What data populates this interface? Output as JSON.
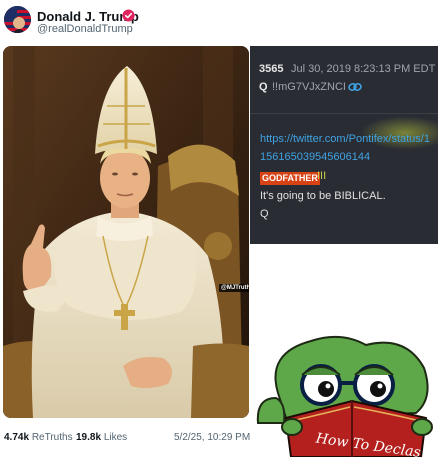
{
  "header": {
    "display_name": "Donald J. Trump",
    "handle": "@realDonaldTrump",
    "avatar_icon": "avatar-flag-image",
    "verified_icon": "verified-badge-icon",
    "verified_color": "#e0245e"
  },
  "image": {
    "watermark": "@MJTruthUltra"
  },
  "q_post": {
    "number": "3565",
    "date": "Jul 30, 2019 8:23:13 PM EDT",
    "author": "Q",
    "tripcode": "!!mG7VJxZNCI",
    "link_icon": "link-chain-icon",
    "link": "https://twitter.com/Pontifex/status/1156165039545606144",
    "badge": "GODFATHER",
    "badge_suffix": "III",
    "message": "It's going to be BIBLICAL.",
    "signature": "Q",
    "badge_color": "#d84315",
    "link_color": "#3fa3e4"
  },
  "sticker": {
    "book_title": "How To Declas"
  },
  "stats": {
    "retruths_count": "4.74k",
    "retruths_label": "ReTruths",
    "likes_count": "19.8k",
    "likes_label": "Likes",
    "timestamp": "5/2/25, 10:29 PM"
  }
}
